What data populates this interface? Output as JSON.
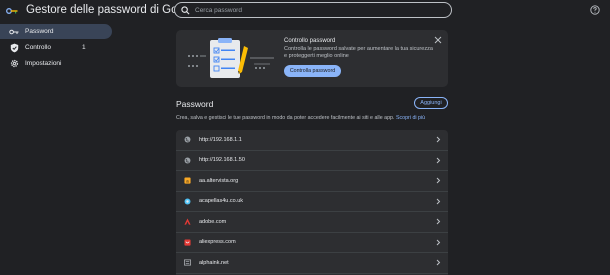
{
  "app": {
    "title": "Gestore delle password di Google"
  },
  "search": {
    "placeholder": "Cerca password"
  },
  "sidebar": {
    "items": [
      {
        "label": "Password",
        "icon": "key-icon",
        "active": true,
        "count": ""
      },
      {
        "label": "Controllo",
        "icon": "shield-check-icon",
        "active": false,
        "count": "1"
      },
      {
        "label": "Impostazioni",
        "icon": "gear-icon",
        "active": false,
        "count": ""
      }
    ]
  },
  "promo": {
    "title": "Controllo password",
    "description": "Controlla le password salvate per aumentare la tua sicurezza e proteggerti meglio online",
    "button": "Controlla password"
  },
  "passwords": {
    "title": "Password",
    "add_button": "Aggiungi",
    "description": "Crea, salva e gestisci le tue password in modo da poter accedere facilmente ai siti e alle app.",
    "learn_more": "Scopri di più",
    "items": [
      {
        "label": "http://192.168.1.1",
        "icon": "globe-icon",
        "color": "#9aa0a6"
      },
      {
        "label": "http://192.168.1.50",
        "icon": "globe-icon",
        "color": "#9aa0a6"
      },
      {
        "label": "aa.altervista.org",
        "icon": "altervista-icon",
        "color": "#f9a825"
      },
      {
        "label": "acapellas4u.co.uk",
        "icon": "acapellas-icon",
        "color": "#4fc3f7"
      },
      {
        "label": "adobe.com",
        "icon": "adobe-icon",
        "color": "#e53935"
      },
      {
        "label": "aliexpress.com",
        "icon": "aliexpress-icon",
        "color": "#e53935"
      },
      {
        "label": "alphaink.net",
        "icon": "alphaink-icon",
        "color": "#bdc1c6"
      }
    ]
  },
  "colors": {
    "background": "#202124",
    "surface": "#2d2e31",
    "accent": "#8ab4f8",
    "active_nav": "#394457"
  }
}
